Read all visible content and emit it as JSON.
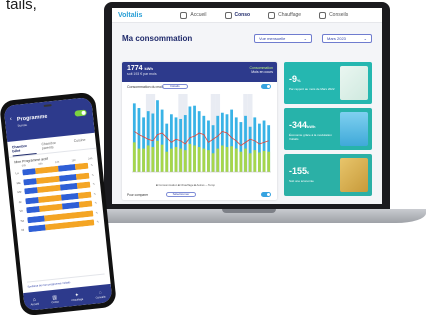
{
  "caption": "tails,",
  "app": {
    "logo": "Voltalis",
    "nav": [
      {
        "label": "Accueil",
        "active": false,
        "icon": "home-icon"
      },
      {
        "label": "Conso",
        "active": true,
        "icon": "bars-icon"
      },
      {
        "label": "Chauffage",
        "active": false,
        "icon": "thermo-icon"
      },
      {
        "label": "Conseils",
        "active": false,
        "icon": "bulb-icon"
      }
    ],
    "page_title": "Ma consommation",
    "period_select": "Vue mensuelle",
    "month_select": "Mars 2023",
    "summary": {
      "value": "1774",
      "unit": "kWh",
      "sub": "soit 193 € par mois",
      "right_top": "Consommation",
      "right_bottom": "Mois en cours"
    },
    "chart_label": "Consommation du mois",
    "chart_pill": "Détails",
    "legend": "■ Consommation  ■ Chauffage  ■ Autres  ─ Temp",
    "compare_label": "Pour comparer",
    "compare_pill": "Sélectionner",
    "tiles": [
      {
        "value": "-9",
        "unit": "%",
        "text": "Par rapport au mois de Mars 2022",
        "color": "#25b7b0"
      },
      {
        "value": "-344",
        "unit": "kWh",
        "text": "Économie grâce à la modulation Voltalis",
        "color": "#27b3aa"
      },
      {
        "value": "-155",
        "unit": "€",
        "text": "Soit une économie",
        "color": "#2bb0a6"
      }
    ]
  },
  "chart_data": {
    "type": "bar",
    "categories": [
      "1",
      "2",
      "3",
      "4",
      "5",
      "6",
      "7",
      "8",
      "9",
      "10",
      "11",
      "12",
      "13",
      "14",
      "15",
      "16",
      "17",
      "18",
      "19",
      "20",
      "21",
      "22",
      "23",
      "24",
      "25",
      "26",
      "27",
      "28",
      "29",
      "30"
    ],
    "series": [
      {
        "values": [
          88,
          82,
          70,
          78,
          75,
          92,
          80,
          62,
          74,
          70,
          68,
          73,
          84,
          85,
          78,
          72,
          66,
          60,
          72,
          76,
          74,
          80,
          70,
          64,
          72,
          58,
          70,
          62,
          66,
          60
        ]
      },
      {
        "values": [
          38,
          30,
          30,
          34,
          32,
          40,
          35,
          26,
          30,
          32,
          30,
          28,
          36,
          34,
          32,
          30,
          28,
          24,
          30,
          34,
          32,
          33,
          30,
          26,
          30,
          24,
          28,
          25,
          27,
          26
        ]
      },
      {
        "values": [
          52,
          48,
          45,
          42,
          40,
          48,
          50,
          44,
          38,
          42,
          40,
          36,
          44,
          46,
          50,
          48,
          38,
          42,
          46,
          52,
          50,
          44,
          40,
          34,
          38,
          42,
          40,
          36,
          38,
          40
        ]
      }
    ],
    "ylim": [
      0,
      100
    ]
  },
  "phone": {
    "title": "Programme",
    "subtitle": "Bureau",
    "tabs": [
      "Chambre bébé",
      "Chambre parents",
      "Cuisine"
    ],
    "active_tab": 0,
    "plan_label": "Mon  Programme actif",
    "hours": [
      "00h",
      "06h",
      "12h",
      "18h",
      "24h"
    ],
    "days": [
      {
        "day": "Lu",
        "segs": [
          [
            "#2f5fd6",
            0.2
          ],
          [
            "#f4a524",
            0.35
          ],
          [
            "#2f5fd6",
            0.25
          ],
          [
            "#f4a524",
            0.2
          ]
        ]
      },
      {
        "day": "Ma",
        "segs": [
          [
            "#2f5fd6",
            0.2
          ],
          [
            "#f4a524",
            0.35
          ],
          [
            "#2f5fd6",
            0.25
          ],
          [
            "#f4a524",
            0.2
          ]
        ]
      },
      {
        "day": "Me",
        "segs": [
          [
            "#2f5fd6",
            0.2
          ],
          [
            "#f4a524",
            0.35
          ],
          [
            "#2f5fd6",
            0.25
          ],
          [
            "#f4a524",
            0.2
          ]
        ]
      },
      {
        "day": "Je",
        "segs": [
          [
            "#2f5fd6",
            0.2
          ],
          [
            "#f4a524",
            0.35
          ],
          [
            "#2f5fd6",
            0.25
          ],
          [
            "#f4a524",
            0.2
          ]
        ]
      },
      {
        "day": "Ve",
        "segs": [
          [
            "#2f5fd6",
            0.2
          ],
          [
            "#f4a524",
            0.35
          ],
          [
            "#2f5fd6",
            0.25
          ],
          [
            "#f4a524",
            0.2
          ]
        ]
      },
      {
        "day": "Sa",
        "segs": [
          [
            "#2f5fd6",
            0.25
          ],
          [
            "#f4a524",
            0.75
          ]
        ]
      },
      {
        "day": "Di",
        "segs": [
          [
            "#2f5fd6",
            0.25
          ],
          [
            "#f4a524",
            0.75
          ]
        ]
      }
    ],
    "note": "Synthèse de mon programme Voltalis",
    "bottom_nav": [
      {
        "label": "Accueil",
        "icon": "home-icon"
      },
      {
        "label": "Conso",
        "icon": "bars-icon"
      },
      {
        "label": "Chauffage",
        "icon": "thermo-icon"
      },
      {
        "label": "Conseils",
        "icon": "bulb-icon"
      }
    ]
  }
}
